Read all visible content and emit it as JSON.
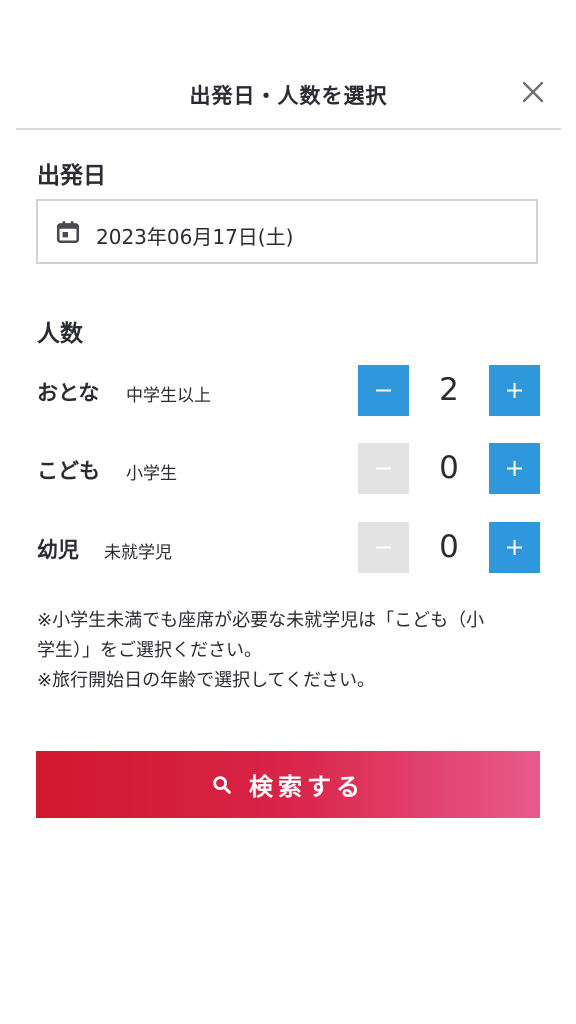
{
  "header": {
    "title": "出発日・人数を選択",
    "close_icon": "close-icon"
  },
  "departure": {
    "heading": "出発日",
    "date": "2023年06月17日(土)",
    "icon": "calendar-icon"
  },
  "passengers": {
    "heading": "人数",
    "rows": [
      {
        "label": "おとな",
        "sub": "中学生以上",
        "count": "2",
        "minus": "−",
        "plus": "+",
        "minus_enabled": true
      },
      {
        "label": "こども",
        "sub": "小学生",
        "count": "0",
        "minus": "−",
        "plus": "+",
        "minus_enabled": false
      },
      {
        "label": "幼児",
        "sub": "未就学児",
        "count": "0",
        "minus": "−",
        "plus": "+",
        "minus_enabled": false
      }
    ]
  },
  "notes": {
    "line1": "※小学生未満でも座席が必要な未就学児は「こども（小",
    "line2": "学生）」をご選択ください。",
    "line3": "※旅行開始日の年齢で選択してください。"
  },
  "search": {
    "label": "検索する",
    "icon": "search-icon"
  },
  "colors": {
    "accent_blue": "#2f97dc",
    "disabled_gray": "#e3e3e3",
    "search_gradient_start": "#d0182f",
    "search_gradient_end": "#e85a8c"
  }
}
